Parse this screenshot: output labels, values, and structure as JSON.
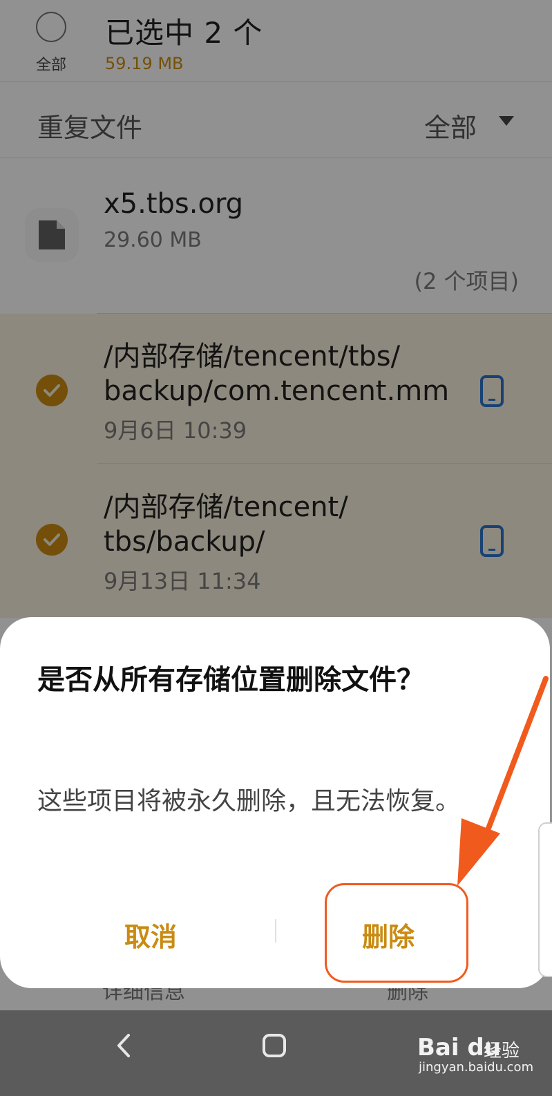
{
  "header": {
    "select_all_label": "全部",
    "title": "已选中 2 个",
    "total_size": "59.19 MB"
  },
  "filter": {
    "label": "重复文件",
    "value": "全部"
  },
  "file_group": {
    "name": "x5.tbs.org",
    "size": "29.60 MB",
    "count": "(2 个项目)",
    "items": [
      {
        "path_line1": "/内部存储/tencent/tbs/",
        "path_line2": "backup/com.tencent.mm",
        "date": "9月6日 10:39"
      },
      {
        "path_line1": "/内部存储/tencent/",
        "path_line2": "tbs/backup/",
        "date": "9月13日 11:34"
      }
    ]
  },
  "dialog": {
    "title": "是否从所有存储位置删除文件？",
    "message": "这些项目将被永久删除，且无法恢复。",
    "cancel_label": "取消",
    "delete_label": "删除"
  },
  "bottom_actions": {
    "details_label": "详细信息",
    "delete_label": "删除"
  },
  "watermark": {
    "logo": "Bai du",
    "site": "经验",
    "domain": "jingyan.baidu.com"
  },
  "colors": {
    "accent": "#c98b12",
    "annotation": "#f15a1d",
    "check": "#c88811",
    "phone_icon": "#2a72c9"
  }
}
